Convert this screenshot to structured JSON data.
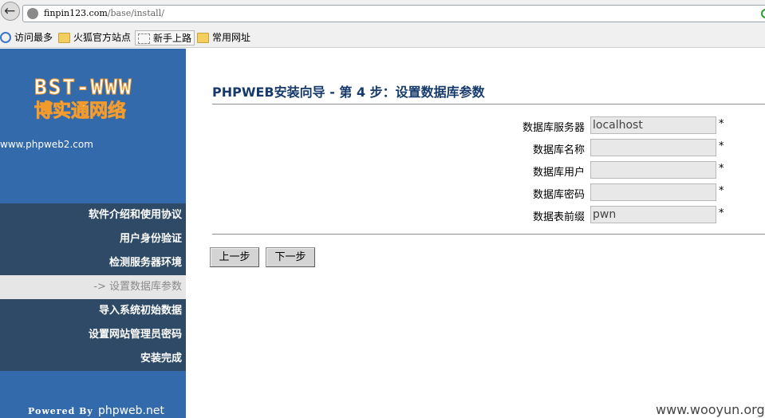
{
  "browser": {
    "url_host": "finpin123.com",
    "url_path": "/base/install/",
    "bookmarks": [
      {
        "label": "访问最多",
        "icon": "most-visited-icon"
      },
      {
        "label": "火狐官方站点",
        "icon": "folder-icon"
      },
      {
        "label": "新手上路",
        "icon": "dashed-page-icon"
      },
      {
        "label": "常用网址",
        "icon": "folder-icon"
      }
    ]
  },
  "sidebar": {
    "logo_top": "BST-WWW",
    "logo_bottom": "博实通网络",
    "site_link": "www.phpweb2.com",
    "steps": [
      {
        "label": "软件介绍和使用协议"
      },
      {
        "label": "用户身份验证"
      },
      {
        "label": "检测服务器环境"
      },
      {
        "label": "-> 设置数据库参数"
      },
      {
        "label": "导入系统初始数据"
      },
      {
        "label": "设置网站管理员密码"
      },
      {
        "label": "安装完成"
      }
    ],
    "powered_by": "Powered By",
    "powered_site": "phpweb.net"
  },
  "main": {
    "title": "PHPWEB安装向导 - 第 4 步：设置数据库参数",
    "fields": [
      {
        "label": "数据库服务器",
        "value": "localhost",
        "required": "*"
      },
      {
        "label": "数据库名称",
        "value": "",
        "required": "*"
      },
      {
        "label": "数据库用户",
        "value": "",
        "required": "*"
      },
      {
        "label": "数据库密码",
        "value": "",
        "required": "*"
      },
      {
        "label": "数据表前缀",
        "value": "pwn",
        "required": "*"
      }
    ],
    "prev_button": "上一步",
    "next_button": "下一步"
  },
  "watermark": "www.wooyun.org",
  "colors": {
    "sidebar_bg": "#336aab",
    "step_bg": "#2e4a66",
    "step_current_bg": "#e6e6e6",
    "title_color": "#163a6b",
    "logo_outline": "#f39a2c"
  }
}
